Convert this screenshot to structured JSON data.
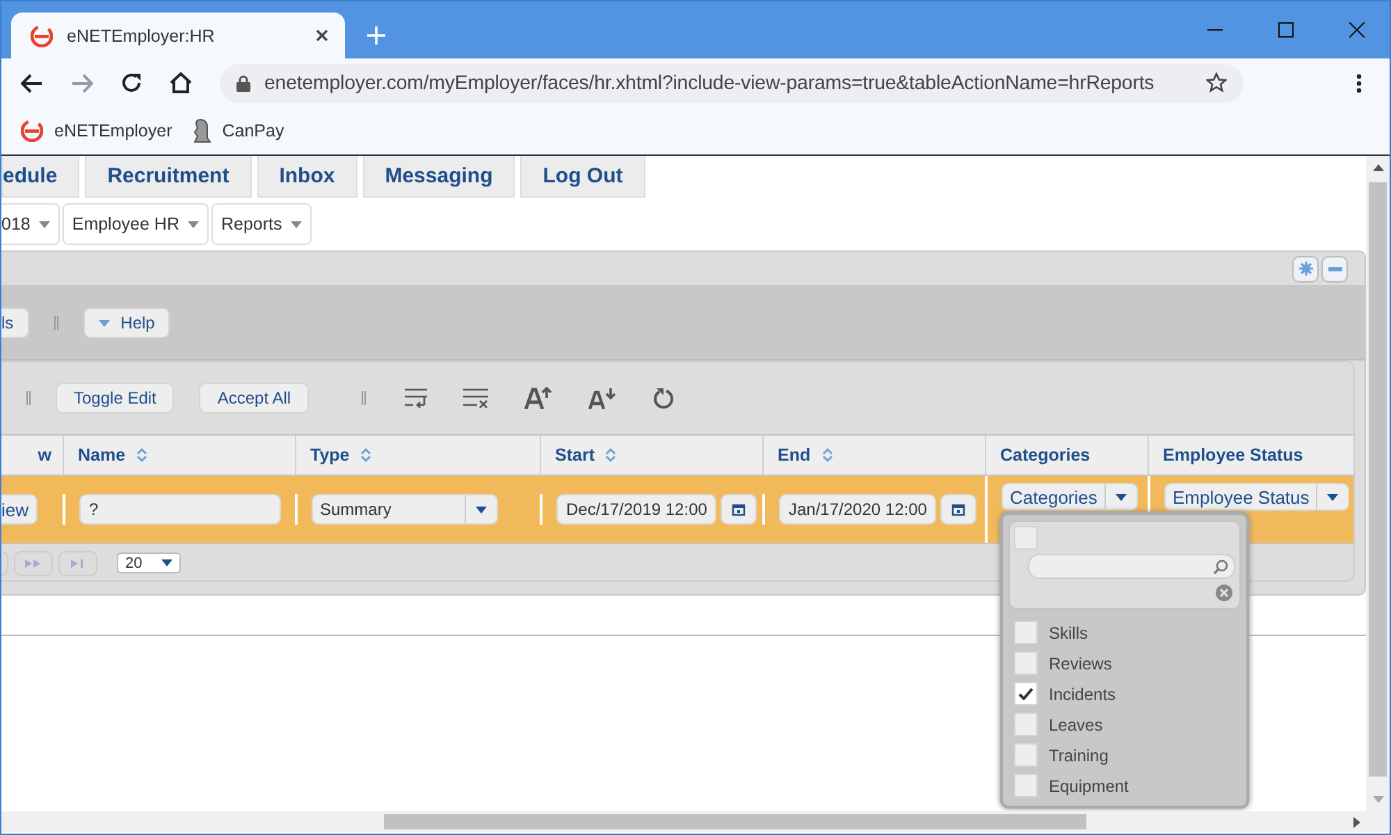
{
  "browser": {
    "tab_title": "eNETEmployer:HR",
    "url": "enetemployer.com/myEmployer/faces/hr.xhtml?include-view-params=true&tableActionName=hrReports",
    "bookmarks": [
      {
        "label": "eNETEmployer",
        "kind": "brand"
      },
      {
        "label": "CanPay",
        "kind": "figure"
      }
    ]
  },
  "nav_tabs": [
    {
      "label": "edule"
    },
    {
      "label": "Recruitment"
    },
    {
      "label": "Inbox"
    },
    {
      "label": "Messaging"
    },
    {
      "label": "Log Out"
    }
  ],
  "menus": [
    {
      "label": "018"
    },
    {
      "label": "Employee HR"
    },
    {
      "label": "Reports"
    }
  ],
  "panel_toolbar": [
    {
      "label": "ls",
      "kind": "button"
    },
    {
      "label": "Help",
      "kind": "menu"
    }
  ],
  "table_toolbar": {
    "buttons": [
      {
        "label": "Toggle Edit"
      },
      {
        "label": "Accept All"
      }
    ]
  },
  "table": {
    "columns": [
      {
        "label": "w",
        "sortable": false
      },
      {
        "label": "Name",
        "sortable": true
      },
      {
        "label": "Type",
        "sortable": true
      },
      {
        "label": "Start",
        "sortable": true
      },
      {
        "label": "End",
        "sortable": true
      },
      {
        "label": "Categories",
        "sortable": false
      },
      {
        "label": "Employee Status",
        "sortable": false
      }
    ],
    "rows": [
      {
        "selected": true,
        "cells": [
          {
            "kind": "button",
            "value": "iew"
          },
          {
            "kind": "text",
            "value": "?"
          },
          {
            "kind": "select",
            "value": "Summary"
          },
          {
            "kind": "date",
            "value": "Dec/17/2019 12:00"
          },
          {
            "kind": "date",
            "value": "Jan/17/2020 12:00"
          },
          {
            "kind": "multiselect",
            "value": "Categories"
          },
          {
            "kind": "multiselect",
            "value": "Employee Status"
          }
        ]
      }
    ]
  },
  "paginator": {
    "rows_per_page": "20"
  },
  "categories_popup": {
    "select_all_checked": false,
    "options": [
      {
        "label": "Skills",
        "checked": false
      },
      {
        "label": "Reviews",
        "checked": false
      },
      {
        "label": "Incidents",
        "checked": true
      },
      {
        "label": "Leaves",
        "checked": false
      },
      {
        "label": "Training",
        "checked": false
      },
      {
        "label": "Equipment",
        "checked": false
      }
    ]
  }
}
